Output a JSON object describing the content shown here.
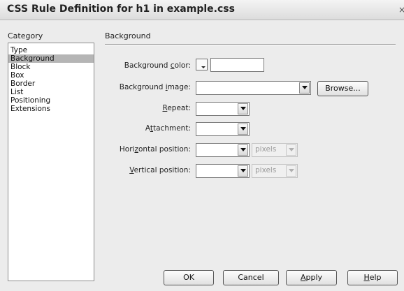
{
  "window": {
    "title": "CSS Rule Definition for h1 in example.css",
    "close_glyph": "×"
  },
  "category": {
    "label": "Category",
    "items": [
      "Type",
      "Background",
      "Block",
      "Box",
      "Border",
      "List",
      "Positioning",
      "Extensions"
    ],
    "selected": "Background"
  },
  "panel": {
    "title": "Background",
    "fields": {
      "background_color": {
        "label_pre": "Background ",
        "label_u": "c",
        "label_post": "olor:",
        "value": ""
      },
      "background_image": {
        "label_pre": "Background ",
        "label_u": "i",
        "label_post": "mage:",
        "value": ""
      },
      "repeat": {
        "label_pre": "",
        "label_u": "R",
        "label_post": "epeat:",
        "value": ""
      },
      "attachment": {
        "label_pre": "A",
        "label_u": "t",
        "label_post": "tachment:",
        "value": ""
      },
      "horizontal_position": {
        "label_pre": "Hori",
        "label_u": "z",
        "label_post": "ontal position:",
        "value": "",
        "unit": "pixels"
      },
      "vertical_position": {
        "label_pre": "",
        "label_u": "V",
        "label_post": "ertical position:",
        "value": "",
        "unit": "pixels"
      }
    },
    "browse_label": "Browse..."
  },
  "buttons": {
    "ok": "OK",
    "cancel": "Cancel",
    "apply_u": "A",
    "apply_rest": "pply",
    "help_u": "H",
    "help_rest": "elp"
  },
  "colors": {
    "dialog_bg": "#ececec",
    "selection": "#b5b5b5"
  },
  "icons": {
    "dropdown": "chevron-down-icon",
    "color_swatch": "color-picker-icon",
    "close": "close-icon"
  }
}
